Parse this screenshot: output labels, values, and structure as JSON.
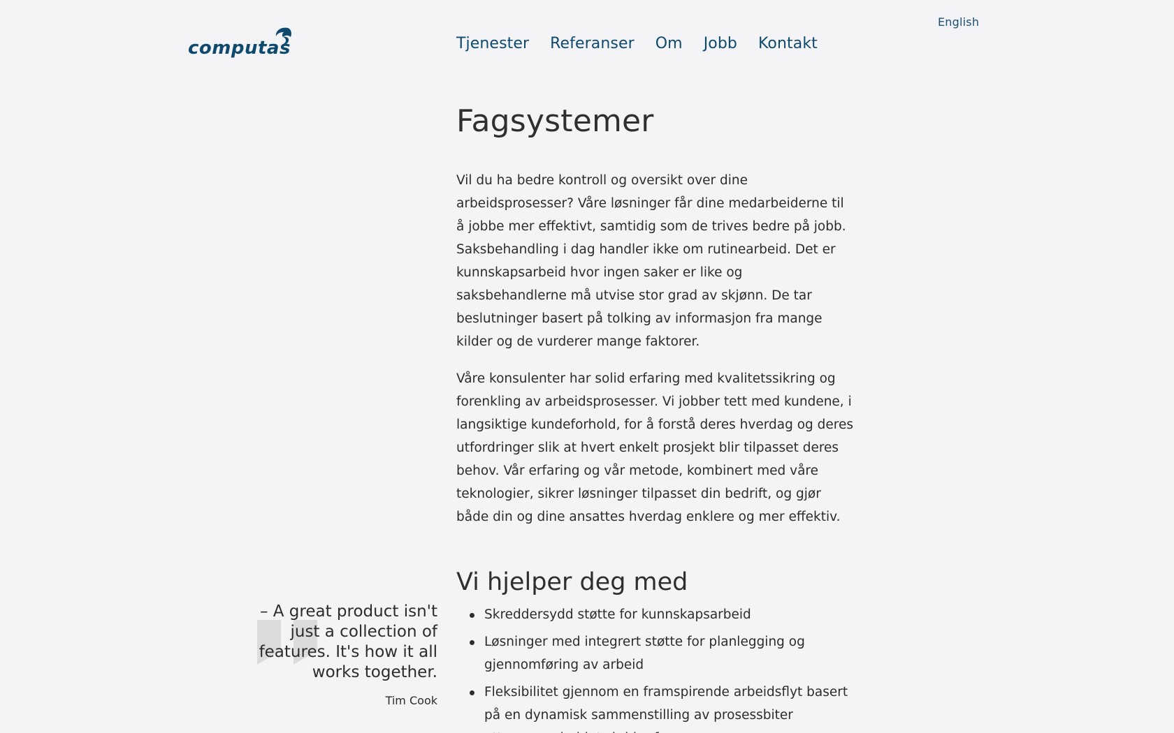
{
  "header": {
    "language_link": "English",
    "logo_text": "computas",
    "nav": [
      "Tjenester",
      "Referanser",
      "Om",
      "Jobb",
      "Kontakt"
    ]
  },
  "main": {
    "title": "Fagsystemer",
    "paragraphs": [
      "Vil du ha bedre kontroll og oversikt over dine arbeidsprosesser? Våre løsninger får dine medarbeiderne til å jobbe mer effektivt, samtidig som de trives bedre på jobb. Saksbehandling i dag handler ikke om rutinearbeid. Det er kunnskapsarbeid hvor ingen saker er like og saksbehandlerne må utvise stor grad av skjønn. De tar beslutninger basert på tolking av informasjon fra mange kilder og de vurderer mange faktorer.",
      "Våre konsulenter har solid erfaring med kvalitetssikring og forenkling av arbeidsprosesser. Vi jobber tett med kundene, i langsiktige kundeforhold, for å forstå deres hverdag og deres utfordringer slik at hvert enkelt prosjekt blir tilpasset deres behov. Vår erfaring og vår metode, kombinert med våre teknologier, sikrer løsninger tilpasset din bedrift, og gjør både din og dine ansattes hverdag enklere og mer effektiv."
    ],
    "section_title": "Vi hjelper deg med",
    "features": [
      "Skreddersydd støtte for kunnskapsarbeid",
      "Løsninger med integrert støtte for planlegging og gjennomføring av arbeid",
      "Fleksibilitet gjennom en framspirende arbeidsflyt basert på en dynamisk sammenstilling av prosessbiter ettersom arbeidet skrider fram"
    ]
  },
  "quote": {
    "text": "– A great product isn't just a collection of features. It's how it all works together.",
    "author": "Tim Cook"
  },
  "colors": {
    "background": "#f4f4f6",
    "brand": "#0e4a6e",
    "text": "#2c2c2c",
    "quote_mark": "#dcdcde"
  }
}
